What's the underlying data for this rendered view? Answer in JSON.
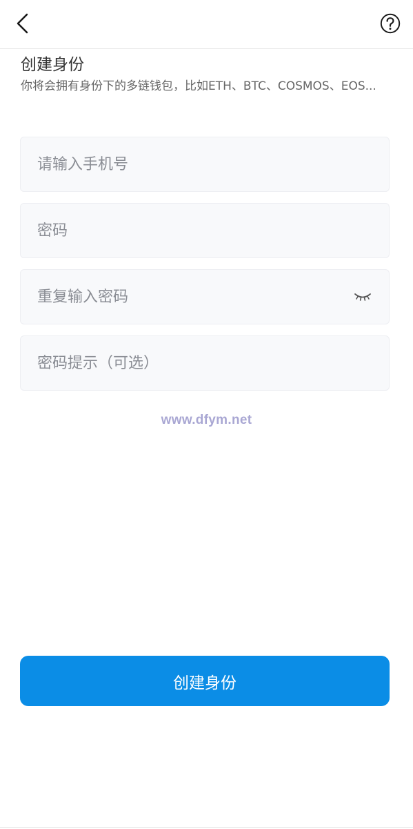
{
  "header": {
    "back_icon": "chevron-left-icon",
    "help_icon": "question-circle-icon"
  },
  "title": "创建身份",
  "subtitle": "你将会拥有身份下的多链钱包，比如ETH、BTC、COSMOS、EOS...",
  "form": {
    "phone_placeholder": "请输入手机号",
    "password_placeholder": "密码",
    "repeat_password_placeholder": "重复输入密码",
    "password_hint_placeholder": "密码提示（可选）",
    "eye_icon": "eye-closed-icon"
  },
  "watermark": "www.dfym.net",
  "submit_label": "创建身份",
  "colors": {
    "accent": "#0b8de6",
    "field_bg": "#f8f9fb",
    "watermark": "#a9a7d3"
  }
}
